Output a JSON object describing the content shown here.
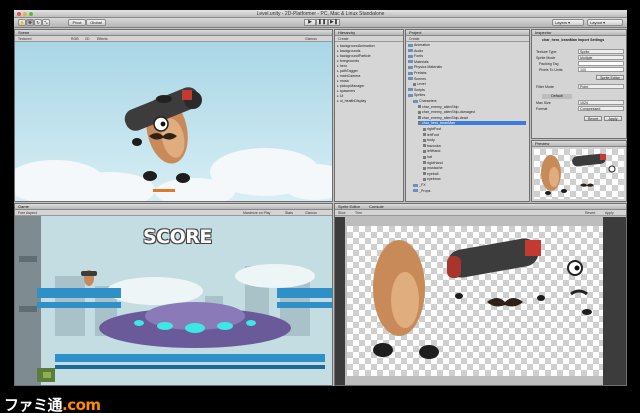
{
  "window": {
    "title": "Level.unity - 2D-Platformer - PC, Mac & Linux Standalone"
  },
  "toolbar": {
    "tools": [
      "hand-tool",
      "move-tool",
      "rotate-tool",
      "scale-tool"
    ],
    "pivot_label": "Pivot",
    "space_label": "Global",
    "layers_label": "Layers",
    "layout_label": "Layout"
  },
  "scene_top": {
    "tab": "Scene",
    "shading": "Textured",
    "options": [
      "RGB",
      "2D",
      "Effects"
    ],
    "gizmos": "Gizmos"
  },
  "hierarchy": {
    "tab": "Hierarchy",
    "create": "Create",
    "items": [
      "backgroundAnimation",
      "backgrounds",
      "backgroundParticle",
      "foregrounds",
      "hero",
      "pathTagger",
      "mainCamera",
      "music",
      "pickupManager",
      "spawners",
      "UI",
      "ui_healthDisplay"
    ]
  },
  "project": {
    "tab": "Project",
    "create": "Create",
    "items": [
      "Animation",
      "Audio",
      "Fonts",
      "Materials",
      "Physics Materials",
      "Prefabs",
      "Scenes",
      "Level",
      "Scripts",
      "Sprites",
      "Characters",
      "char_enemy_alienShip",
      "char_enemy_alienShip-damaged",
      "char_enemy_alienShip-dead",
      "char_hero_beanMan",
      "rightFoot",
      "leftFoot",
      "body",
      "bazooka",
      "leftHand",
      "hat",
      "rightHand",
      "mustache",
      "eyeball",
      "eyebrow",
      "_FX",
      "_Props"
    ]
  },
  "inspector": {
    "tab": "Inspector",
    "asset": "char_hero_beanMan Import Settings",
    "fields": [
      {
        "label": "Texture Type",
        "value": "Sprite"
      },
      {
        "label": "Sprite Mode",
        "value": "Multiple"
      },
      {
        "label": "Packing Tag",
        "value": ""
      },
      {
        "label": "Pixels To Units",
        "value": "100"
      }
    ],
    "sprite_editor": "Sprite Editor",
    "filter_label": "Filter Mode",
    "filter_value": "Point",
    "platform": "Default",
    "max_size_label": "Max Size",
    "max_size_value": "1024",
    "format_label": "Format",
    "format_value": "Compressed",
    "revert": "Revert",
    "apply": "Apply",
    "preview_tab": "Preview"
  },
  "game": {
    "tab": "Game",
    "aspect": "Free Aspect",
    "maximize": "Maximize on Play",
    "stats": "Stats",
    "gizmos": "Gizmos",
    "score": "SCORE"
  },
  "sprite_editor": {
    "tab": "Sprite Editor",
    "tab2": "Console",
    "slice": "Slice",
    "trim": "Trim",
    "revert": "Revert",
    "apply": "Apply"
  },
  "watermark": {
    "brand": "ファミ通",
    "suffix": ".com"
  },
  "colors": {
    "selection": "#3d7dd8",
    "sky": "#b8dde8",
    "bean": "#c98a5a",
    "bazooka": "#3c3c3c",
    "ufo": "#6a5a9a",
    "ufo_glow": "#3ee6e6"
  }
}
